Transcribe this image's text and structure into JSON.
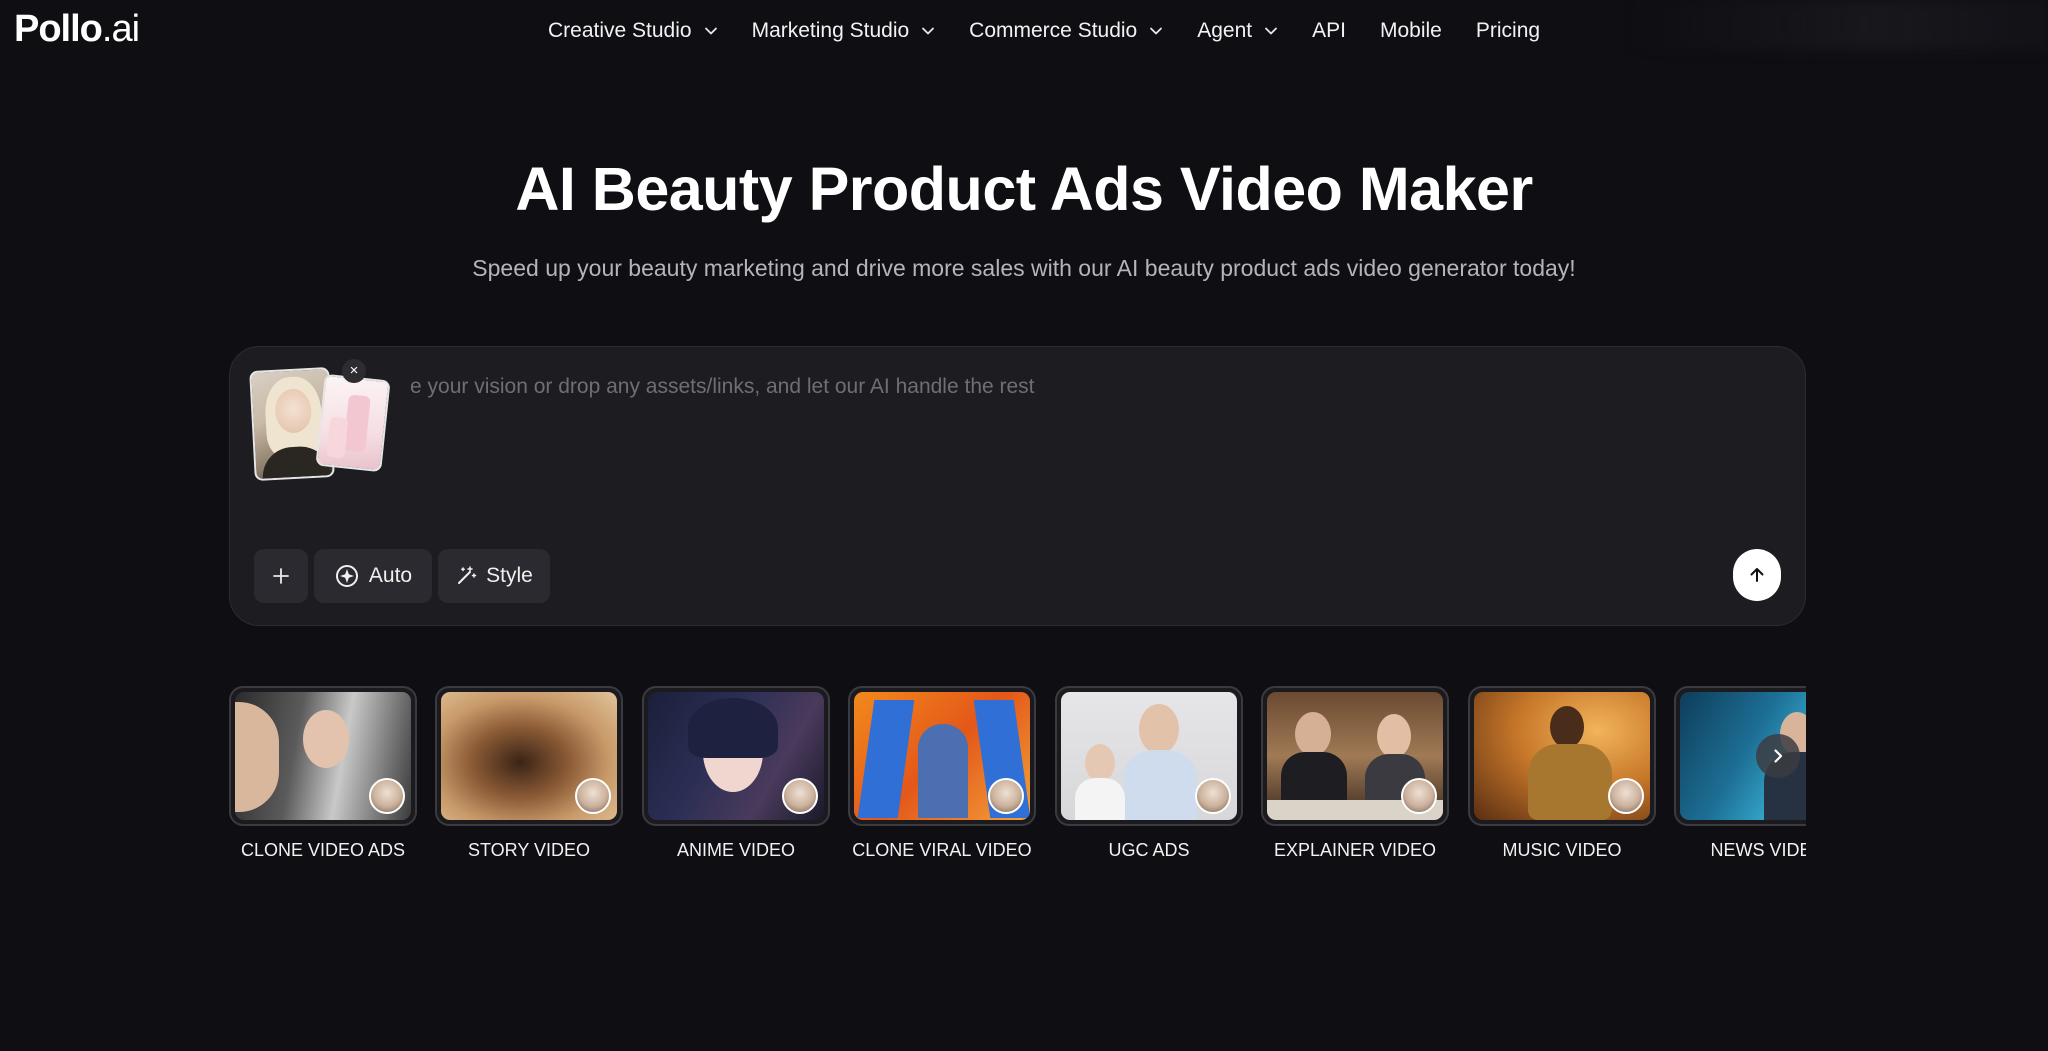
{
  "logo": {
    "brand": "Pollo",
    "suffix": ".ai"
  },
  "nav": {
    "items": [
      {
        "label": "Creative Studio",
        "dropdown": true
      },
      {
        "label": "Marketing Studio",
        "dropdown": true
      },
      {
        "label": "Commerce Studio",
        "dropdown": true
      },
      {
        "label": "Agent",
        "dropdown": true
      },
      {
        "label": "API",
        "dropdown": false
      },
      {
        "label": "Mobile",
        "dropdown": false
      },
      {
        "label": "Pricing",
        "dropdown": false
      }
    ]
  },
  "hero": {
    "title": "AI Beauty Product Ads Video Maker",
    "subtitle": "Speed up your beauty marketing and drive more sales with our AI beauty product ads video generator today!"
  },
  "prompt": {
    "placeholder": "e your vision or drop any assets/links, and let our AI handle the rest",
    "remove_label": "×",
    "tools": {
      "add_label": "+",
      "auto_label": "Auto",
      "style_label": "Style"
    }
  },
  "templates": {
    "items": [
      {
        "label": "CLONE VIDEO ADS"
      },
      {
        "label": "STORY VIDEO"
      },
      {
        "label": "ANIME VIDEO"
      },
      {
        "label": "CLONE VIRAL VIDEO"
      },
      {
        "label": "UGC ADS"
      },
      {
        "label": "EXPLAINER VIDEO"
      },
      {
        "label": "MUSIC VIDEO"
      },
      {
        "label": "NEWS VIDEO"
      }
    ]
  },
  "colors": {
    "background": "#0e0e13",
    "panel": "#1c1c21",
    "button": "#2a2a30",
    "text": "#ffffff",
    "muted": "#b4b4bc"
  }
}
